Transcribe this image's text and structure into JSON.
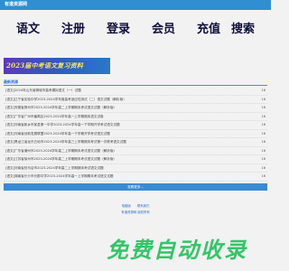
{
  "site": {
    "title": "有道资源网"
  },
  "nav": {
    "items": [
      {
        "label": "语文"
      },
      {
        "label": "注册"
      },
      {
        "label": "登录"
      },
      {
        "label": "会员"
      },
      {
        "label": "充值"
      },
      {
        "label": "搜索"
      }
    ]
  },
  "banner": {
    "text": "2023届中考语文复习资料"
  },
  "list": {
    "title": "最新资源",
    "items": [
      {
        "title": "[语文]2024年山东省聊城市高考模拟语文（一）试题",
        "count": "16"
      },
      {
        "title": "[语文]辽宁省实验中学2023-2024学年度高考适应性测试（二）语文试题（解析版）",
        "count": "16"
      },
      {
        "title": "[语文]安徽省滁州市2023-2024学年高二上学期期末考试语文试题（解析版）",
        "count": "16"
      },
      {
        "title": "[语文]广东省广州市番禺区2023-2024学年高一上学期期末语文试卷",
        "count": "16"
      },
      {
        "title": "[语文]河南省新乡市某县第一中学2023-2024学年高一下学期开学考试语文试题",
        "count": "16"
      },
      {
        "title": "[语文]河南省创新发展联盟2023-2024学年高一下学期开学考试语文试题",
        "count": "16"
      },
      {
        "title": "[语文]黑龙江省龙东五地市2023-2024学年高三上学期期末考试第一次联考语文试题",
        "count": "16"
      },
      {
        "title": "[语文]广东省潮州市2023-2024学年高二上学期期末考试语文试题（解析版）",
        "count": "16"
      },
      {
        "title": "[语文]江苏省徐州市2023-2024学年高二上学期期末考试语文试题（解析版）",
        "count": "16"
      },
      {
        "title": "[语文]河南省驻马店市2023-2024学年高二上学期期末考试语文试题",
        "count": "16"
      },
      {
        "title": "[语文]湖南省长沙市长郡中学2023-2024学年高一上学期期末考试语文试题",
        "count": "16"
      }
    ],
    "more_label": "查看更多..."
  },
  "footer": {
    "links": [
      {
        "label": "电脑版"
      },
      {
        "label": "联系我们"
      }
    ],
    "copyright": "有道资源网 版权所有"
  },
  "watermark": {
    "text": "免费自动收录"
  },
  "colors": {
    "brand": "#2f8fd0",
    "watermark": "#35c468"
  }
}
